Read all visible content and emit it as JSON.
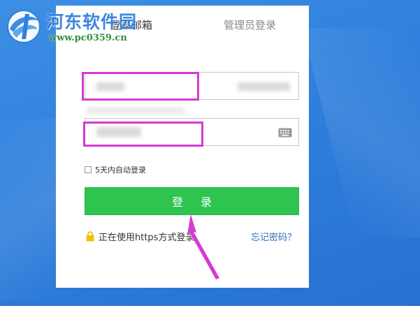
{
  "watermark": {
    "site_name": "河东软件园",
    "url": "www.pc0359.cn"
  },
  "tabs": {
    "email_login": "登录邮箱",
    "admin_login": "管理员登录"
  },
  "form": {
    "username_placeholder": "",
    "password_placeholder": "",
    "remember_label": "5天内自动登录",
    "login_button": "登 录",
    "https_note": "正在使用https方式登录",
    "forgot_password": "忘记密码？"
  },
  "colors": {
    "background": "#2f7fdc",
    "login_button": "#2fc350",
    "highlight": "#d63ad3",
    "annotation_arrow": "#d63ad3",
    "link": "#2f6fba"
  },
  "icons": {
    "keyboard": "keyboard-icon",
    "lock": "lock-icon"
  }
}
